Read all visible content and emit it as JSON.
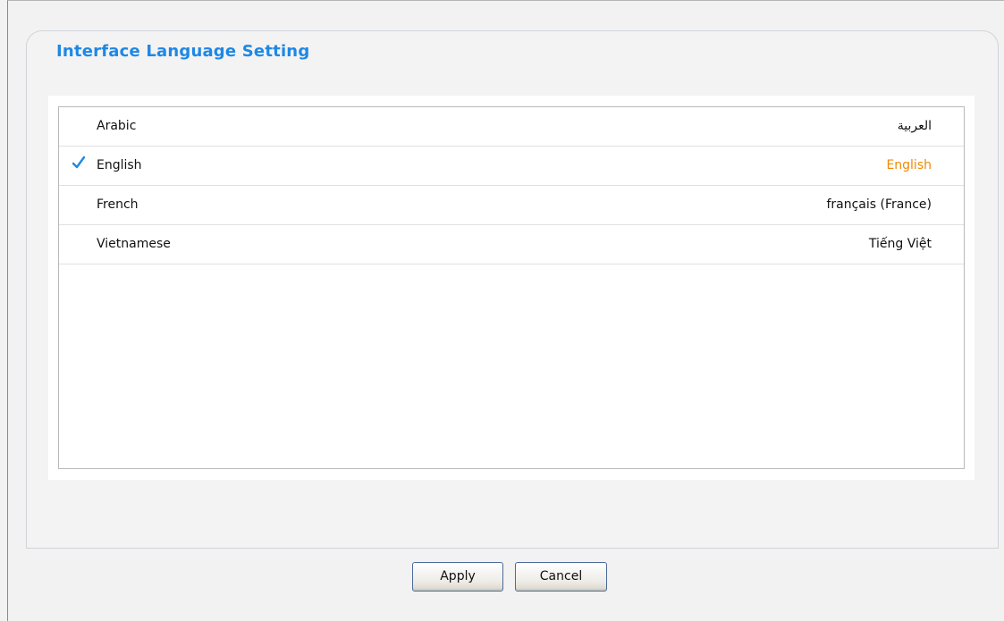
{
  "panel": {
    "title": "Interface Language Setting"
  },
  "languages": [
    {
      "name": "Arabic",
      "native": "العربية",
      "selected": false
    },
    {
      "name": "English",
      "native": "English",
      "selected": true
    },
    {
      "name": "French",
      "native": "français (France)",
      "selected": false
    },
    {
      "name": "Vietnamese",
      "native": "Tiếng Việt",
      "selected": false
    }
  ],
  "buttons": {
    "apply_label": "Apply",
    "cancel_label": "Cancel"
  },
  "colors": {
    "title": "#1e88e5",
    "selected_native": "#f08a00",
    "checkmark": "#1e88e5"
  },
  "icons": {
    "selected_marker": "checkmark-icon"
  }
}
